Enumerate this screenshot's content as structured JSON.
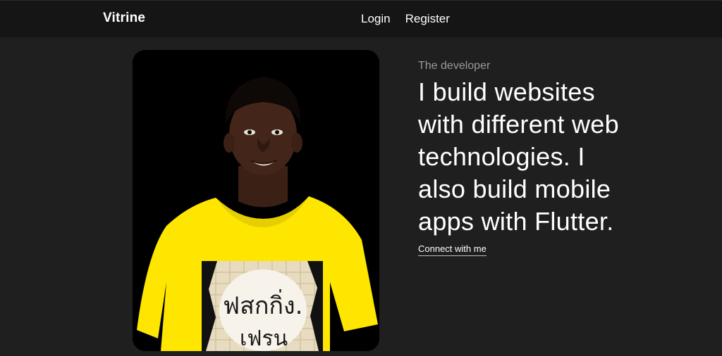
{
  "header": {
    "brand": "Vitrine",
    "nav": [
      {
        "label": "Login"
      },
      {
        "label": "Register"
      }
    ]
  },
  "hero": {
    "eyebrow": "The developer",
    "headline": "I build websites with different web technologies. I also build mobile apps with Flutter.",
    "cta_label": "Connect with me",
    "photo": {
      "shirt_text_line1": "ฟสกกิ่ง.",
      "shirt_text_line2": "เฟรน"
    }
  },
  "colors": {
    "background": "#1f1f1f",
    "navbar": "#151515",
    "text": "#ffffff",
    "muted": "#9a9a9a",
    "shirt": "#ffe600"
  }
}
